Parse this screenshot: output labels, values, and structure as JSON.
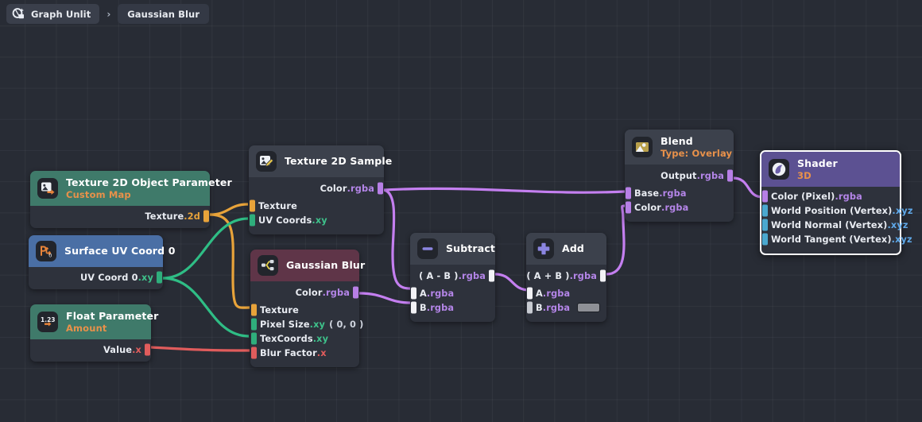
{
  "app": {
    "background_color": "#282c35",
    "grid_color": "#3a3f4a"
  },
  "breadcrumb": {
    "root_label": "Graph Unlit",
    "root_icon": "graph-unlit-icon",
    "separator": "›",
    "current_label": "Gaussian Blur"
  },
  "nodes": [
    {
      "id": "texture-2d-object-parameter",
      "title": "Texture 2D Object Parameter",
      "subtitle": "Custom Map",
      "header_color": "#3f7a6a",
      "icon": "image-export-icon",
      "outputs": [
        {
          "label": "Texture",
          "suffix": ".2d",
          "type": "2d"
        }
      ],
      "inputs": []
    },
    {
      "id": "surface-uv-coord-0",
      "title": "Surface UV Coord 0",
      "subtitle": "",
      "header_color": "#4a6fa5",
      "icon": "uv-coord-icon",
      "outputs": [
        {
          "label": "UV Coord 0",
          "suffix": ".xy",
          "type": "xy"
        }
      ],
      "inputs": []
    },
    {
      "id": "float-parameter",
      "title": "Float Parameter",
      "subtitle": "Amount",
      "header_color": "#3f7a6a",
      "icon": "float-value-icon",
      "outputs": [
        {
          "label": "Value",
          "suffix": ".x",
          "type": "x"
        }
      ],
      "inputs": []
    },
    {
      "id": "texture-2d-sample",
      "title": "Texture 2D Sample",
      "subtitle": "",
      "header_color": "#3c414c",
      "icon": "texture-sample-icon",
      "outputs": [
        {
          "label": "Color",
          "suffix": ".rgba",
          "type": "rgba"
        }
      ],
      "inputs": [
        {
          "label": "Texture",
          "suffix": "",
          "type": "tex"
        },
        {
          "label": "UV Coords",
          "suffix": ".xy",
          "type": "xy"
        }
      ]
    },
    {
      "id": "gaussian-blur",
      "title": "Gaussian Blur",
      "subtitle": "",
      "header_color": "#5f3548",
      "icon": "subgraph-icon",
      "outputs": [
        {
          "label": "Color",
          "suffix": ".rgba",
          "type": "rgba"
        }
      ],
      "inputs": [
        {
          "label": "Texture",
          "suffix": "",
          "type": "tex",
          "value": ""
        },
        {
          "label": "Pixel Size",
          "suffix": ".xy",
          "type": "xy",
          "value": "( 0, 0 )"
        },
        {
          "label": "TexCoords",
          "suffix": ".xy",
          "type": "xy",
          "value": ""
        },
        {
          "label": "Blur Factor",
          "suffix": ".x",
          "type": "x",
          "value": ""
        }
      ]
    },
    {
      "id": "subtract",
      "title": "Subtract",
      "subtitle": "",
      "header_color": "#3c414c",
      "icon": "minus-icon",
      "outputs": [
        {
          "label": "( A - B )",
          "suffix": ".rgba",
          "type": "rgba-w"
        }
      ],
      "inputs": [
        {
          "label": "A",
          "suffix": ".rgba",
          "type": "rgba-w"
        },
        {
          "label": "B",
          "suffix": ".rgba",
          "type": "rgba-w"
        }
      ]
    },
    {
      "id": "add",
      "title": "Add",
      "subtitle": "",
      "header_color": "#3c414c",
      "icon": "plus-icon",
      "outputs": [
        {
          "label": "( A + B )",
          "suffix": ".rgba",
          "type": "rgba-w"
        }
      ],
      "inputs": [
        {
          "label": "A",
          "suffix": ".rgba",
          "type": "rgba-w"
        },
        {
          "label": "B",
          "suffix": ".rgba",
          "type": "gray",
          "swatch": "#8e9096"
        }
      ]
    },
    {
      "id": "blend",
      "title": "Blend",
      "subtitle": "Type: Overlay",
      "header_color": "#3c414c",
      "icon": "blend-image-icon",
      "outputs": [
        {
          "label": "Output",
          "suffix": ".rgba",
          "type": "rgba"
        }
      ],
      "inputs": [
        {
          "label": "Base",
          "suffix": ".rgba",
          "type": "rgba"
        },
        {
          "label": "Color",
          "suffix": ".rgba",
          "type": "rgba"
        }
      ]
    },
    {
      "id": "shader",
      "title": "Shader",
      "subtitle": "3D",
      "header_color": "#5c5192",
      "icon": "shader-output-icon",
      "selected": true,
      "outputs": [],
      "inputs": [
        {
          "label": "Color (Pixel)",
          "suffix": ".rgba",
          "type": "rgba"
        },
        {
          "label": "World Position (Vertex)",
          "suffix": ".xyz",
          "type": "cyan"
        },
        {
          "label": "World Normal (Vertex)",
          "suffix": ".xyz",
          "type": "cyan"
        },
        {
          "label": "World Tangent (Vertex)",
          "suffix": ".xyz",
          "type": "cyan"
        }
      ]
    }
  ],
  "labels": {
    "texparam_title": "Texture 2D Object Parameter",
    "texparam_sub": "Custom Map",
    "texparam_out": "Texture",
    "texparam_out_sfx": ".2d",
    "uv_title": "Surface UV Coord 0",
    "uv_out": "UV Coord 0",
    "uv_out_sfx": ".xy",
    "float_title": "Float Parameter",
    "float_sub": "Amount",
    "float_out": "Value",
    "float_out_sfx": ".x",
    "tsample_title": "Texture 2D Sample",
    "tsample_out": "Color",
    "tsample_out_sfx": ".rgba",
    "tsample_in1": "Texture",
    "tsample_in2": "UV Coords",
    "tsample_in2_sfx": ".xy",
    "gblur_title": "Gaussian Blur",
    "gblur_out": "Color",
    "gblur_out_sfx": ".rgba",
    "gblur_in1": "Texture",
    "gblur_in2": "Pixel Size",
    "gblur_in2_sfx": ".xy",
    "gblur_in2_val": "( 0, 0 )",
    "gblur_in3": "TexCoords",
    "gblur_in3_sfx": ".xy",
    "gblur_in4": "Blur Factor",
    "gblur_in4_sfx": ".x",
    "sub_title": "Subtract",
    "sub_out": "( A - B )",
    "sub_out_sfx": ".rgba",
    "sub_inA": "A",
    "sub_inA_sfx": ".rgba",
    "sub_inB": "B",
    "sub_inB_sfx": ".rgba",
    "add_title": "Add",
    "add_out": "( A + B )",
    "add_out_sfx": ".rgba",
    "add_inA": "A",
    "add_inA_sfx": ".rgba",
    "add_inB": "B",
    "add_inB_sfx": ".rgba",
    "blend_title": "Blend",
    "blend_sub": "Type: Overlay",
    "blend_out": "Output",
    "blend_out_sfx": ".rgba",
    "blend_in1": "Base",
    "blend_in1_sfx": ".rgba",
    "blend_in2": "Color",
    "blend_in2_sfx": ".rgba",
    "shader_title": "Shader",
    "shader_sub": "3D",
    "shader_in1": "Color (Pixel)",
    "shader_in1_sfx": ".rgba",
    "shader_in2": "World Position (Vertex)",
    "shader_in2_sfx": ".xyz",
    "shader_in3": "World Normal (Vertex)",
    "shader_in3_sfx": ".xyz",
    "shader_in4": "World Tangent (Vertex)",
    "shader_in4_sfx": ".xyz"
  },
  "connections": [
    {
      "from": "texture-2d-object-parameter.Texture",
      "to": "texture-2d-sample.Texture",
      "color": "#e8a33a"
    },
    {
      "from": "texture-2d-object-parameter.Texture",
      "to": "gaussian-blur.Texture",
      "color": "#e8a33a"
    },
    {
      "from": "surface-uv-coord-0.UV Coord 0",
      "to": "texture-2d-sample.UV Coords",
      "color": "#2fbd85"
    },
    {
      "from": "surface-uv-coord-0.UV Coord 0",
      "to": "gaussian-blur.TexCoords",
      "color": "#2fbd85"
    },
    {
      "from": "float-parameter.Value",
      "to": "gaussian-blur.Blur Factor",
      "color": "#e05c5c"
    },
    {
      "from": "texture-2d-sample.Color",
      "to": "blend.Base",
      "color": "#c47ff0"
    },
    {
      "from": "texture-2d-sample.Color",
      "to": "subtract.A",
      "color": "#c47ff0"
    },
    {
      "from": "gaussian-blur.Color",
      "to": "subtract.B",
      "color": "#c47ff0"
    },
    {
      "from": "subtract.( A - B )",
      "to": "add.A",
      "color": "#c47ff0"
    },
    {
      "from": "add.( A + B )",
      "to": "blend.Color",
      "color": "#c47ff0"
    },
    {
      "from": "blend.Output",
      "to": "shader.Color (Pixel)",
      "color": "#c47ff0"
    }
  ]
}
